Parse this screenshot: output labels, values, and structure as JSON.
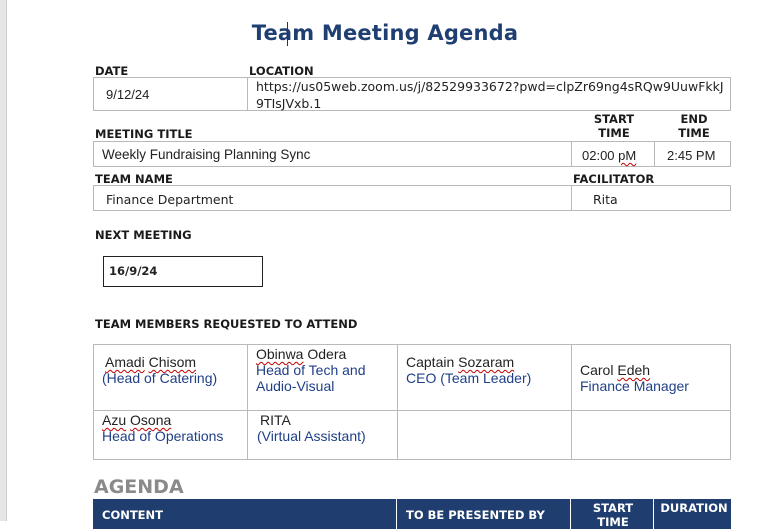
{
  "title": "Team Meeting Agenda",
  "labels": {
    "date": "DATE",
    "location": "LOCATION",
    "meeting_title": "MEETING TITLE",
    "start_time": "START TIME",
    "end_time": "END TIME",
    "team_name": "TEAM NAME",
    "facilitator": "FACILITATOR",
    "next_meeting": "NEXT MEETING",
    "team_members": "TEAM MEMBERS REQUESTED TO ATTEND"
  },
  "meeting": {
    "date": "9/12/24",
    "location": "https://us05web.zoom.us/j/82529933672?pwd=clpZr69ng4sRQw9UuwFkkJ9TIsJVxb.1",
    "title": "Weekly Fundraising Planning Sync",
    "start_time_value": "02:00",
    "start_time_suffix": "pM",
    "end_time": "2:45 PM",
    "team_name": "Finance Department",
    "facilitator": "Rita",
    "next_meeting": "16/9/24"
  },
  "members": [
    {
      "name_a": "Amadi",
      "name_b": "Chisom",
      "role": "(Head of Catering)"
    },
    {
      "name_a": "Obinwa",
      "name_b": "Odera",
      "role": "Head of Tech and Audio-Visual"
    },
    {
      "name_a": "Captain",
      "name_b": "Sozaram",
      "role": "CEO (Team Leader)"
    },
    {
      "name_a": "Carol",
      "name_b": "Edeh",
      "role": "Finance Manager"
    },
    {
      "name_a": "Azu",
      "name_b": "Osona",
      "role": "Head of Operations"
    },
    {
      "name_a": "RITA",
      "name_b": "",
      "role": "(Virtual Assistant)"
    }
  ],
  "agenda": {
    "heading": "AGENDA",
    "columns": {
      "content": "CONTENT",
      "presented_by": "TO BE PRESENTED BY",
      "start_time": "START TIME",
      "duration": "DURATION"
    }
  }
}
